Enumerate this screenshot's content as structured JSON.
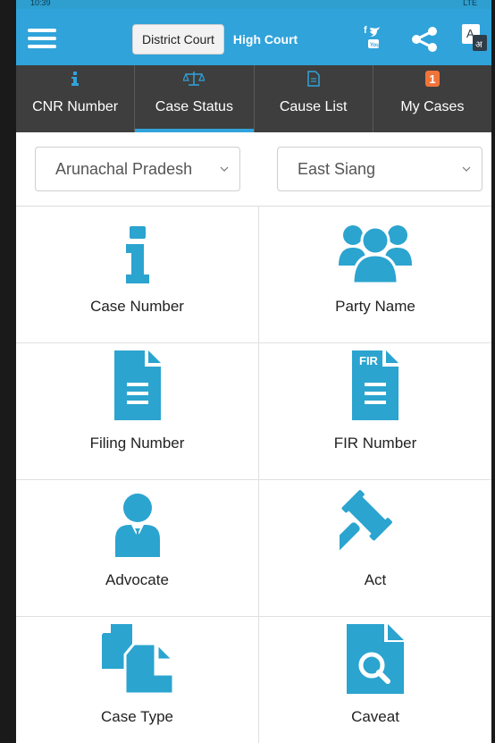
{
  "statusbar": {
    "left": "10:39",
    "right": "LTE"
  },
  "header": {
    "court_options": [
      "District Court",
      "High Court"
    ],
    "active_court": "District Court",
    "translate_glyph_a": "A",
    "translate_glyph_hi": "अ"
  },
  "tabs": [
    {
      "label": "CNR Number",
      "icon": "info-icon"
    },
    {
      "label": "Case Status",
      "icon": "scales-icon"
    },
    {
      "label": "Cause List",
      "icon": "document-icon"
    },
    {
      "label": "My Cases",
      "icon": "count-badge-icon",
      "badge": "1"
    }
  ],
  "active_tab": "Case Status",
  "filters": {
    "state": "Arunachal Pradesh",
    "district": "East Siang"
  },
  "search_options": [
    {
      "label": "Case Number",
      "icon": "info-icon"
    },
    {
      "label": "Party Name",
      "icon": "people-icon"
    },
    {
      "label": "Filing Number",
      "icon": "document-icon"
    },
    {
      "label": "FIR Number",
      "icon": "fir-document-icon"
    },
    {
      "label": "Advocate",
      "icon": "advocate-icon"
    },
    {
      "label": "Act",
      "icon": "gavel-icon"
    },
    {
      "label": "Case Type",
      "icon": "copy-files-icon"
    },
    {
      "label": "Caveat",
      "icon": "search-document-icon"
    }
  ],
  "colors": {
    "accent": "#30a3da",
    "tab_bar": "#3e3e3e",
    "icon": "#2ba4cf",
    "badge": "#f0743a"
  }
}
